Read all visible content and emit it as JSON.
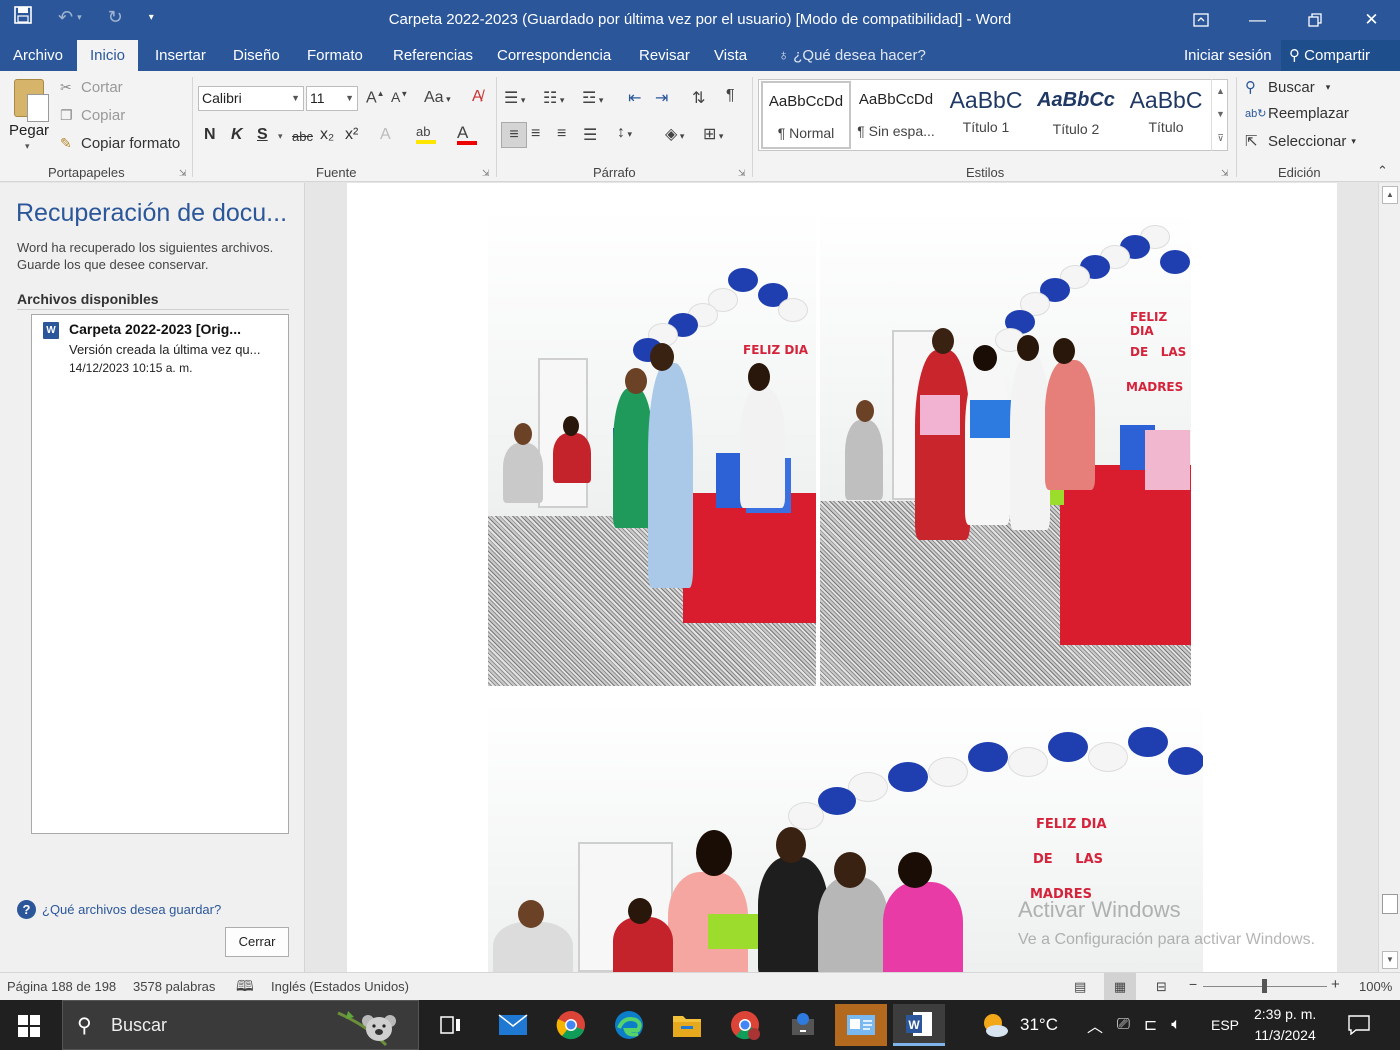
{
  "window": {
    "title": "Carpeta 2022-2023 (Guardado por última vez por el usuario) [Modo de compatibilidad] - Word"
  },
  "tabs": [
    "Archivo",
    "Inicio",
    "Insertar",
    "Diseño",
    "Formato",
    "Referencias",
    "Correspondencia",
    "Revisar",
    "Vista"
  ],
  "active_tab": "Inicio",
  "tell_me": "¿Qué desea hacer?",
  "sign_in": "Iniciar sesión",
  "share": "Compartir",
  "ribbon": {
    "clipboard": {
      "paste": "Pegar",
      "cut": "Cortar",
      "copy": "Copiar",
      "format_painter": "Copiar formato",
      "group_label": "Portapapeles"
    },
    "font": {
      "font_name": "Calibri",
      "font_size": "11",
      "group_label": "Fuente",
      "bold": "N",
      "italic": "K",
      "underline": "S",
      "strike": "abc",
      "subscript": "x₂",
      "superscript": "x²",
      "change_case": "Aa"
    },
    "paragraph": {
      "group_label": "Párrafo"
    },
    "styles": {
      "group_label": "Estilos",
      "items": [
        {
          "sample": "AaBbCcDd",
          "name": "¶ Normal"
        },
        {
          "sample": "AaBbCcDd",
          "name": "¶ Sin espa..."
        },
        {
          "sample": "AaBbC",
          "name": "Título 1"
        },
        {
          "sample": "AaBbCc",
          "name": "Título 2"
        },
        {
          "sample": "AaBbC",
          "name": "Título"
        }
      ]
    },
    "editing": {
      "group_label": "Edición",
      "find": "Buscar",
      "replace": "Reemplazar",
      "select": "Seleccionar"
    }
  },
  "recovery_pane": {
    "title": "Recuperación de docu...",
    "description": "Word ha recuperado los siguientes archivos. Guarde los que desee conservar.",
    "available_label": "Archivos disponibles",
    "file": {
      "name": "Carpeta 2022-2023  [Orig...",
      "version": "Versión creada la última vez qu...",
      "date": "14/12/2023 10:15 a. m."
    },
    "help_link": "¿Qué archivos desea guardar?",
    "close_button": "Cerrar"
  },
  "document": {
    "signs": [
      "FELIZ DIA",
      "DE",
      "LAS",
      "MADRES"
    ]
  },
  "watermark": {
    "line1": "Activar Windows",
    "line2": "Ve a Configuración para activar Windows."
  },
  "statusbar": {
    "page": "Página 188 de 198",
    "words": "3578 palabras",
    "language": "Inglés (Estados Unidos)",
    "zoom": "100%"
  },
  "taskbar": {
    "search_placeholder": "Buscar",
    "weather": "31°C",
    "input_lang": "ESP",
    "time": "2:39 p. m.",
    "date": "11/3/2024"
  }
}
